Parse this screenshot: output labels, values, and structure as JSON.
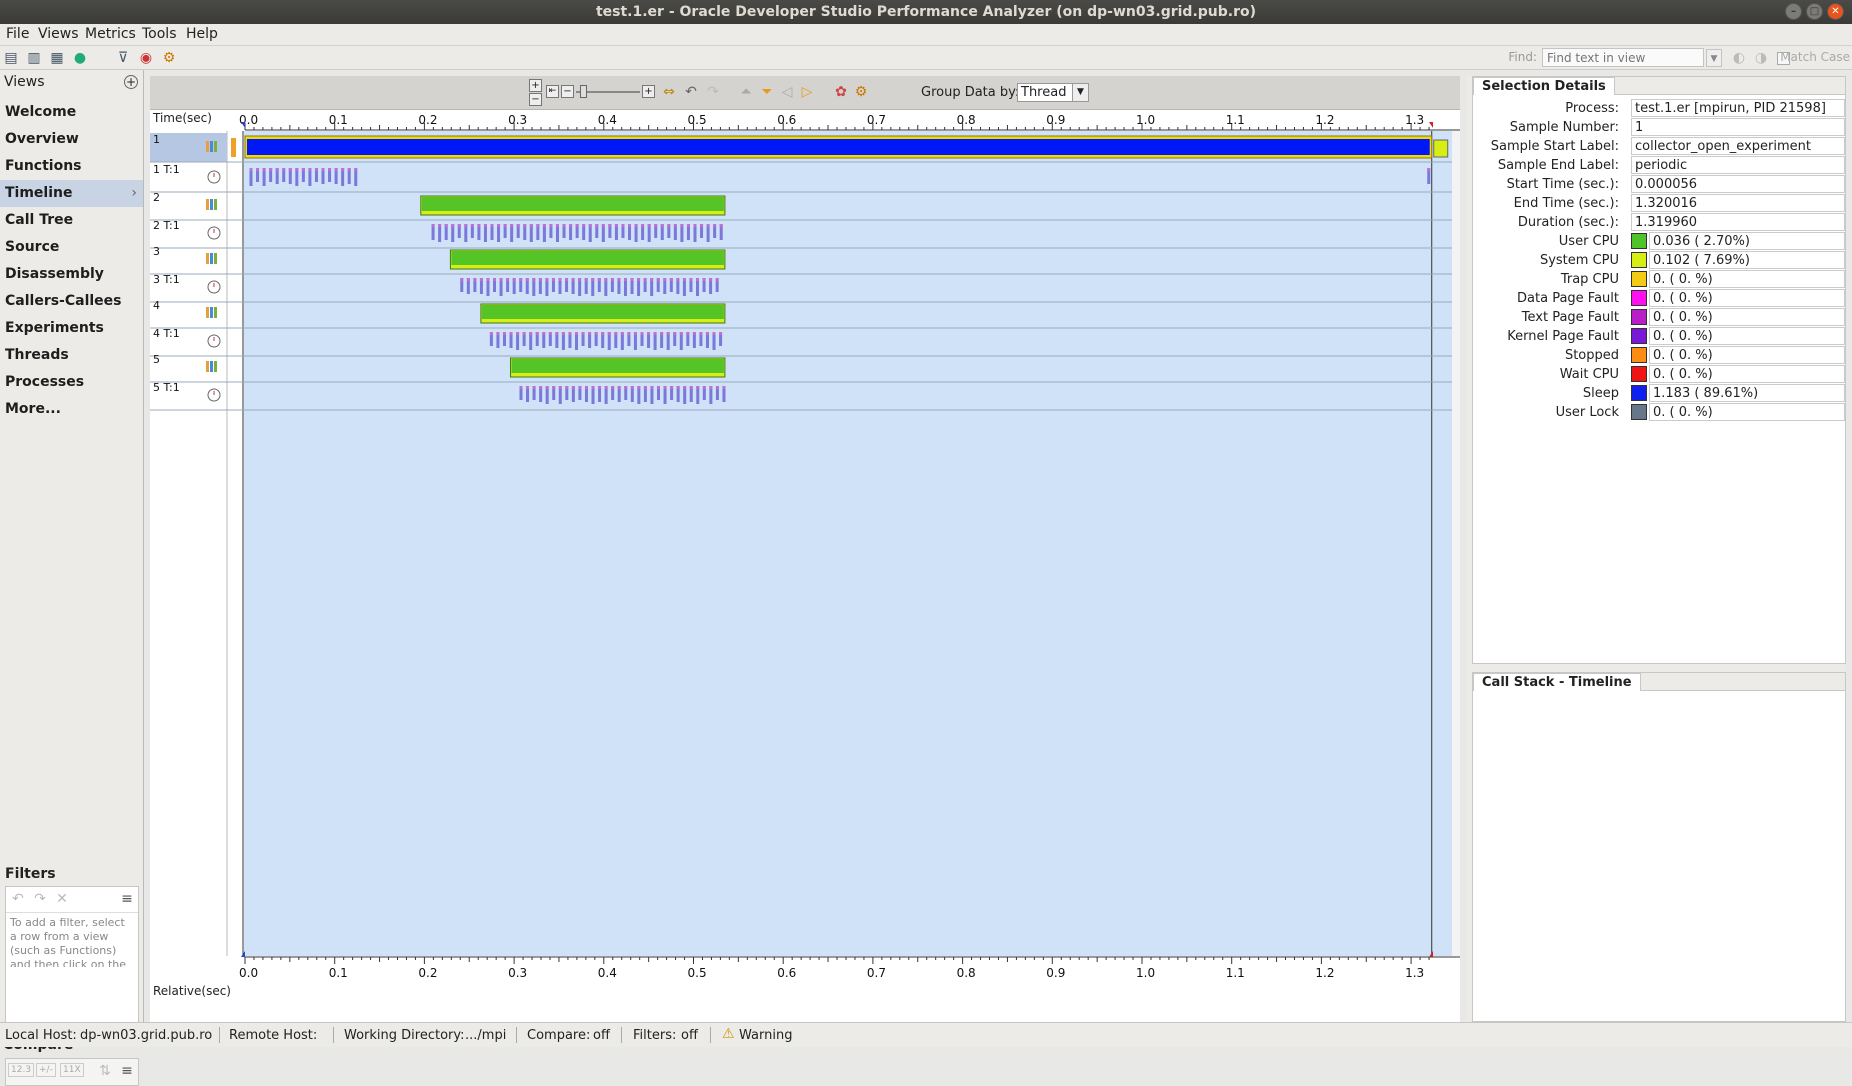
{
  "window": {
    "title": "test.1.er  -  Oracle Developer Studio Performance Analyzer (on dp-wn03.grid.pub.ro)"
  },
  "menu": [
    "File",
    "Views",
    "Metrics",
    "Tools",
    "Help"
  ],
  "find": {
    "label": "Find:",
    "placeholder": "Find text in view",
    "match_case": "Match Case"
  },
  "views": {
    "header": "Views",
    "items": [
      "Welcome",
      "Overview",
      "Functions",
      "Timeline",
      "Call Tree",
      "Source",
      "Disassembly",
      "Callers-Callees",
      "Experiments",
      "Threads",
      "Processes",
      "More..."
    ],
    "selected": "Timeline"
  },
  "filters": {
    "header": "Filters",
    "hint": "To add a filter, select a row from a view (such as Functions) and then click on the"
  },
  "compare": {
    "header": "Compare",
    "buttons": [
      "12.3",
      "+/-",
      "11X"
    ]
  },
  "timeline": {
    "group_label": "Group Data by:",
    "group_value": "Thread",
    "top_axis_label": "Time(sec)",
    "bottom_axis_label": "Relative(sec)",
    "ticks": [
      "0.0",
      "0.1",
      "0.2",
      "0.3",
      "0.4",
      "0.5",
      "0.6",
      "0.7",
      "0.8",
      "0.9",
      "1.0",
      "1.1",
      "1.2",
      "1.3"
    ],
    "rows": [
      {
        "label": "1",
        "kind": "process",
        "start": 0.0,
        "end": 1.323,
        "color": "#0018f5"
      },
      {
        "label": "1 T:1",
        "kind": "thread",
        "start": 0.005,
        "end": 0.125,
        "tail": 1.318
      },
      {
        "label": "2",
        "kind": "process",
        "start": 0.196,
        "end": 0.535,
        "color": "#55c427"
      },
      {
        "label": "2 T:1",
        "kind": "thread",
        "start": 0.208,
        "end": 0.535
      },
      {
        "label": "3",
        "kind": "process",
        "start": 0.229,
        "end": 0.535,
        "color": "#55c427"
      },
      {
        "label": "3 T:1",
        "kind": "thread",
        "start": 0.24,
        "end": 0.53
      },
      {
        "label": "4",
        "kind": "process",
        "start": 0.263,
        "end": 0.535,
        "color": "#55c427"
      },
      {
        "label": "4 T:1",
        "kind": "thread",
        "start": 0.273,
        "end": 0.532
      },
      {
        "label": "5",
        "kind": "process",
        "start": 0.296,
        "end": 0.535,
        "color": "#55c427"
      },
      {
        "label": "5 T:1",
        "kind": "thread",
        "start": 0.306,
        "end": 0.535
      }
    ]
  },
  "selection_details": {
    "tab": "Selection Details",
    "fields": [
      {
        "label": "Process:",
        "value": "test.1.er [mpirun, PID 21598]"
      },
      {
        "label": "Sample Number:",
        "value": "1"
      },
      {
        "label": "Sample Start Label:",
        "value": "collector_open_experiment"
      },
      {
        "label": "Sample End Label:",
        "value": "periodic"
      },
      {
        "label": "Start Time (sec.):",
        "value": "0.000056"
      },
      {
        "label": "End Time (sec.):",
        "value": "1.320016"
      },
      {
        "label": "Duration (sec.):",
        "value": "1.319960"
      }
    ],
    "states": [
      {
        "label": "User CPU",
        "value": "0.036 (  2.70%)",
        "color": "#4fc42a"
      },
      {
        "label": "System CPU",
        "value": "0.102 (  7.69%)",
        "color": "#d7ee14"
      },
      {
        "label": "Trap CPU",
        "value": "0.    (  0.  %)",
        "color": "#f2cc14"
      },
      {
        "label": "Data Page Fault",
        "value": "0.    (  0.  %)",
        "color": "#ff10ee"
      },
      {
        "label": "Text Page Fault",
        "value": "0.    (  0.  %)",
        "color": "#b81fc8"
      },
      {
        "label": "Kernel Page Fault",
        "value": "0.    (  0.  %)",
        "color": "#7a18d8"
      },
      {
        "label": "Stopped",
        "value": "0.    (  0.  %)",
        "color": "#fb8c14"
      },
      {
        "label": "Wait CPU",
        "value": "0.    (  0.  %)",
        "color": "#f01414"
      },
      {
        "label": "Sleep",
        "value": "1.183 ( 89.61%)",
        "color": "#1020ee"
      },
      {
        "label": "User Lock",
        "value": "0.    (  0.  %)",
        "color": "#67778a"
      }
    ]
  },
  "callstack": {
    "tab": "Call Stack - Timeline"
  },
  "status": {
    "local_host_label": "Local Host:",
    "local_host": "dp-wn03.grid.pub.ro",
    "remote_host_label": "Remote Host:",
    "working_dir_label": "Working Directory:",
    "working_dir": ".../mpi",
    "compare_label": "Compare:",
    "compare": "off",
    "filters_label": "Filters:",
    "filters": "off",
    "warning": "Warning"
  },
  "colors": {
    "plot_bg": "#cfe2f8",
    "selected_row": "#b5c7e3"
  }
}
